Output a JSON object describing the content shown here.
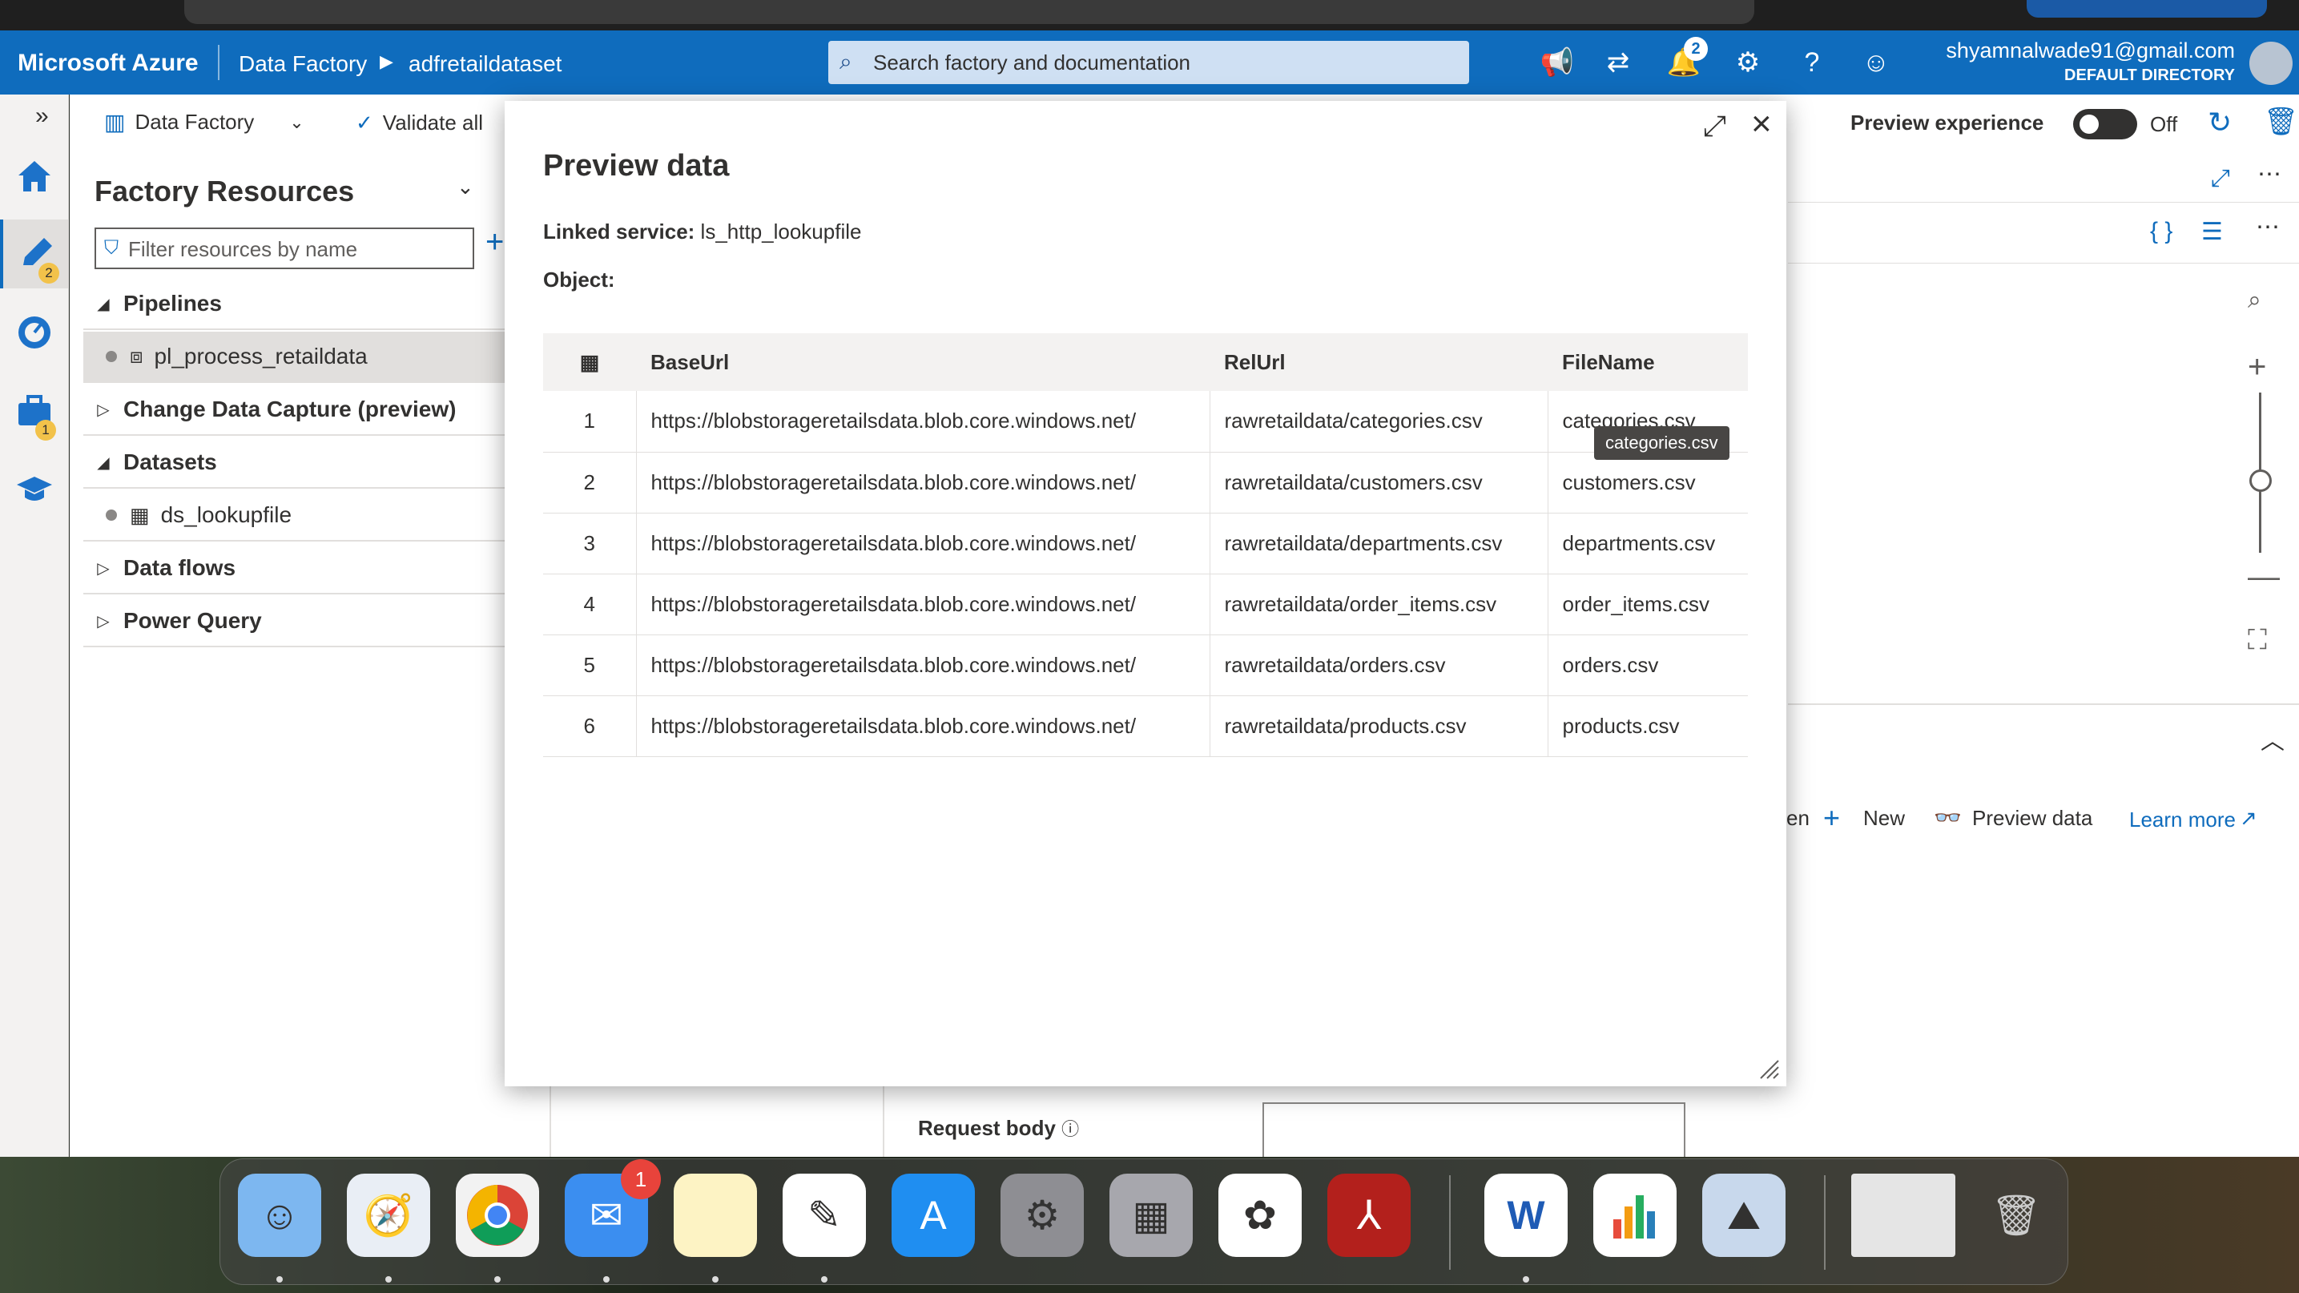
{
  "azure": {
    "brand": "Microsoft Azure",
    "breadcrumb": [
      "Data Factory",
      "adfretaildataset"
    ],
    "search_placeholder": "Search factory and documentation",
    "notifications_count": "2",
    "account_email": "shyamnalwade91@gmail.com",
    "account_directory": "DEFAULT DIRECTORY"
  },
  "rail": {
    "author_badge": "2",
    "manage_badge": "1"
  },
  "toolbar": {
    "data_factory_label": "Data Factory",
    "validate_all_label": "Validate all",
    "preview_experience_label": "Preview experience",
    "toggle_state": "Off"
  },
  "factory_resources": {
    "title": "Factory Resources",
    "filter_placeholder": "Filter resources by name",
    "tree": [
      {
        "type": "group",
        "label": "Pipelines",
        "expanded": true
      },
      {
        "type": "item",
        "label": "pl_process_retaildata",
        "icon": "pipeline-icon",
        "selected": true
      },
      {
        "type": "group",
        "label": "Change Data Capture (preview)",
        "expanded": false
      },
      {
        "type": "group",
        "label": "Datasets",
        "expanded": true
      },
      {
        "type": "item",
        "label": "ds_lookupfile",
        "icon": "dataset-table-icon",
        "selected": false
      },
      {
        "type": "group",
        "label": "Data flows",
        "expanded": false
      },
      {
        "type": "group",
        "label": "Power Query",
        "expanded": false
      }
    ]
  },
  "background": {
    "request_body_label": "Request body",
    "actions": {
      "open_partial": "en",
      "new_label": "New",
      "preview_data_label": "Preview data",
      "learn_more_label": "Learn more"
    }
  },
  "preview_modal": {
    "title": "Preview data",
    "linked_service_key": "Linked service:",
    "linked_service_value": "ls_http_lookupfile",
    "object_key": "Object:",
    "columns": [
      "BaseUrl",
      "RelUrl",
      "FileName"
    ],
    "rows": [
      {
        "n": "1",
        "BaseUrl": "https://blobstorageretailsdata.blob.core.windows.net/",
        "RelUrl": "rawretaildata/categories.csv",
        "FileName": "categories.csv"
      },
      {
        "n": "2",
        "BaseUrl": "https://blobstorageretailsdata.blob.core.windows.net/",
        "RelUrl": "rawretaildata/customers.csv",
        "FileName": "customers.csv"
      },
      {
        "n": "3",
        "BaseUrl": "https://blobstorageretailsdata.blob.core.windows.net/",
        "RelUrl": "rawretaildata/departments.csv",
        "FileName": "departments.csv"
      },
      {
        "n": "4",
        "BaseUrl": "https://blobstorageretailsdata.blob.core.windows.net/",
        "RelUrl": "rawretaildata/order_items.csv",
        "FileName": "order_items.csv"
      },
      {
        "n": "5",
        "BaseUrl": "https://blobstorageretailsdata.blob.core.windows.net/",
        "RelUrl": "rawretaildata/orders.csv",
        "FileName": "orders.csv"
      },
      {
        "n": "6",
        "BaseUrl": "https://blobstorageretailsdata.blob.core.windows.net/",
        "RelUrl": "rawretaildata/products.csv",
        "FileName": "products.csv"
      }
    ],
    "tooltip": "categories.csv"
  },
  "dock": {
    "mail_badge": "1",
    "apps": [
      "finder-icon",
      "safari-icon",
      "chrome-icon",
      "mail-icon",
      "notes-icon",
      "textedit-icon",
      "app-store-icon",
      "system-settings-icon",
      "launchpad-icon",
      "photos-icon",
      "acrobat-icon",
      "word-icon",
      "numbers-icon",
      "preview-icon",
      "screenshot-thumbnail",
      "trash-icon"
    ]
  },
  "colors": {
    "azure_blue": "#0f6cbd",
    "modal_header_bg": "#f3f2f1",
    "tooltip_bg": "#484644"
  }
}
